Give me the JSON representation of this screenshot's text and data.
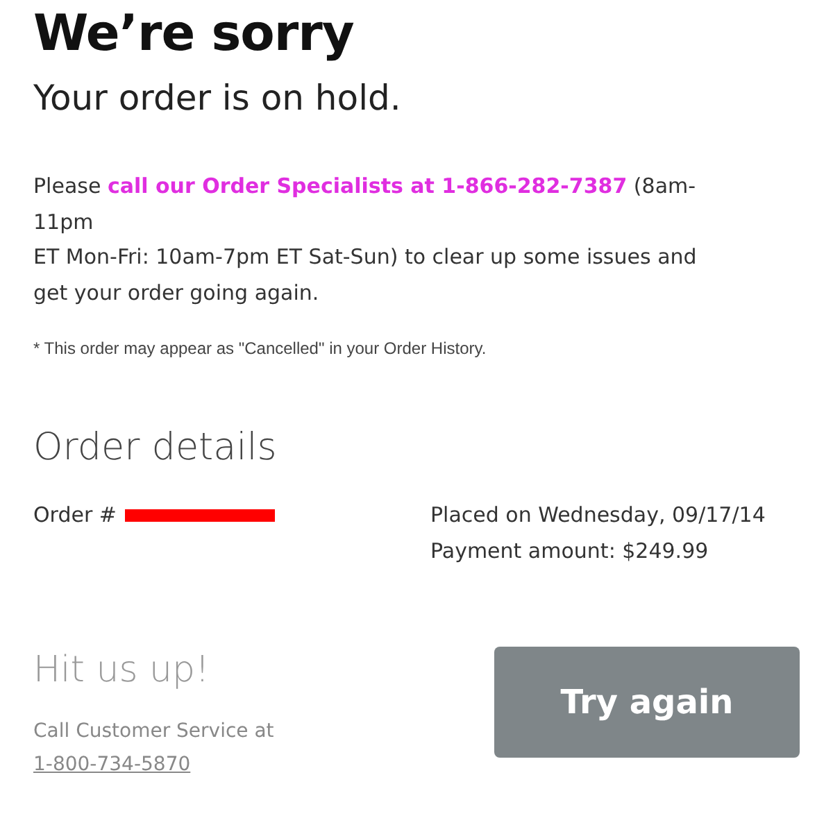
{
  "title": "We’re sorry",
  "subtitle": "Your order is on hold.",
  "message": {
    "lead": "Please ",
    "link": "call our Order Specialists at 1-866-282-7387",
    "rest": " (8am-\n11pm\nET Mon-Fri: 10am-7pm ET Sat-Sun) to clear up some issues and\nget your order going again."
  },
  "note": "* This order may appear as \"Cancelled\" in your Order History.",
  "order_details": {
    "heading": "Order details",
    "order_label": "Order #",
    "placed": "Placed on Wednesday, 09/17/14",
    "payment": "Payment amount: $249.99"
  },
  "contact": {
    "heading": "Hit us up!",
    "text": "Call Customer Service at",
    "phone": "1-800-734-5870"
  },
  "button": "Try again"
}
